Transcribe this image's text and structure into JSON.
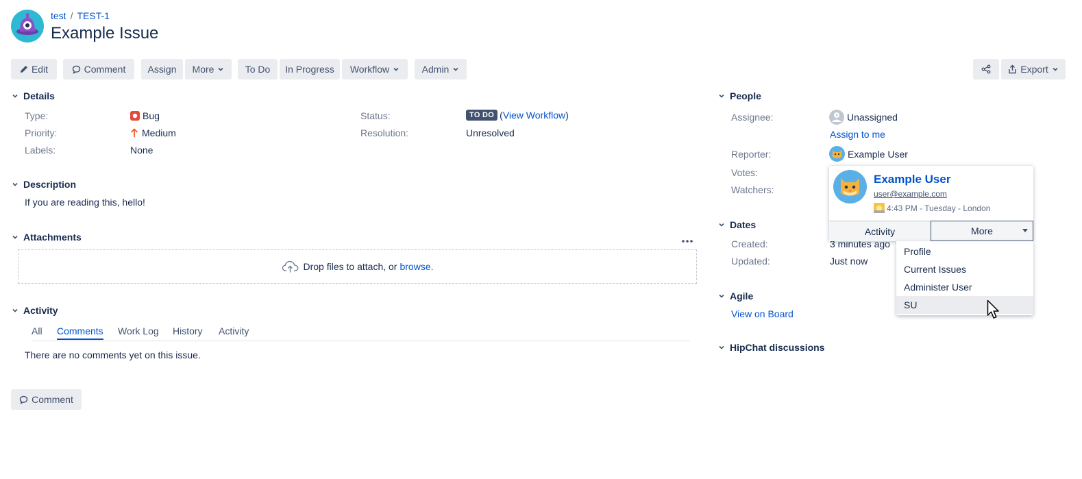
{
  "breadcrumb": {
    "project": "test",
    "separator": "/",
    "issue_key": "TEST-1"
  },
  "title": "Example Issue",
  "toolbar": {
    "edit": "Edit",
    "comment": "Comment",
    "assign": "Assign",
    "more": "More",
    "todo": "To Do",
    "in_progress": "In Progress",
    "workflow": "Workflow",
    "admin": "Admin",
    "export": "Export"
  },
  "details": {
    "heading": "Details",
    "type_label": "Type:",
    "type_value": "Bug",
    "priority_label": "Priority:",
    "priority_value": "Medium",
    "labels_label": "Labels:",
    "labels_value": "None",
    "status_label": "Status:",
    "status_value": "TO DO",
    "status_paren_open": "(",
    "view_workflow": "View Workflow",
    "status_paren_close": ")",
    "resolution_label": "Resolution:",
    "resolution_value": "Unresolved"
  },
  "description": {
    "heading": "Description",
    "text": "If you are reading this, hello!"
  },
  "attachments": {
    "heading": "Attachments",
    "drop_text": "Drop files to attach, or",
    "browse": "browse."
  },
  "activity": {
    "heading": "Activity",
    "tabs": [
      "All",
      "Comments",
      "Work Log",
      "History",
      "Activity"
    ],
    "active_tab": "Comments",
    "empty_text": "There are no comments yet on this issue.",
    "comment_button": "Comment"
  },
  "people": {
    "heading": "People",
    "assignee_label": "Assignee:",
    "assignee_value": "Unassigned",
    "assign_to_me": "Assign to me",
    "reporter_label": "Reporter:",
    "reporter_value": "Example User",
    "votes_label": "Votes:",
    "watchers_label": "Watchers:"
  },
  "dates": {
    "heading": "Dates",
    "created_label": "Created:",
    "created_value": "3 minutes ago",
    "updated_label": "Updated:",
    "updated_value": "Just now"
  },
  "agile": {
    "heading": "Agile",
    "view_on_board": "View on Board"
  },
  "hipchat": {
    "heading": "HipChat discussions"
  },
  "user_card": {
    "name": "Example User",
    "email": "user@example.com",
    "local_time": "4:43 PM - Tuesday - London",
    "activity_button": "Activity",
    "more_button": "More",
    "menu_items": [
      "Profile",
      "Current Issues",
      "Administer User",
      "SU"
    ],
    "hovered_item": "SU"
  },
  "colors": {
    "link": "#0052cc",
    "text": "#172b4d",
    "label": "#6b778c",
    "button_bg": "#ebecf0",
    "bug_red": "#e5493a",
    "priority_orange": "#f15c25",
    "lozenge": "#42526e"
  },
  "icons": [
    "project-avatar-icon",
    "pencil-icon",
    "speech-bubble-icon",
    "chevron-down-icon",
    "share-icon",
    "export-icon",
    "bug-icon",
    "arrow-up-icon",
    "cloud-upload-icon",
    "ellipsis-icon",
    "unknown-user-icon",
    "cat-avatar-icon",
    "sun-icon",
    "mouse-pointer-icon"
  ]
}
